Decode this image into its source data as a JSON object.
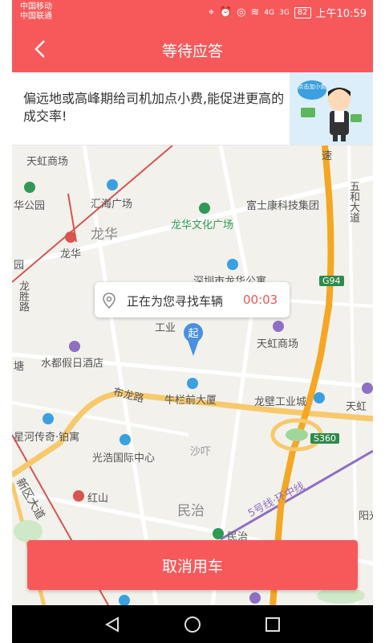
{
  "status_bar": {
    "carrier1": "中国移动",
    "carrier2": "中国联通",
    "signal1": "4G",
    "signal2": "3G",
    "battery": "82",
    "time": "上午10:59"
  },
  "header": {
    "title": "等待应答"
  },
  "tip": {
    "text": "偏远地或高峰期给司机加点小费,能促进更高的成交率!",
    "illustration_text": "点击加小费"
  },
  "map": {
    "labels": {
      "tianhong_top": "天虹商场",
      "huihuan": "汇海广场",
      "park": "华公园",
      "longhua_area": "龙华",
      "longhua_metro": "龙华",
      "yuan": "园",
      "longsheng_road": "龙胜路",
      "culture_plaza": "龙华文化广场",
      "fushikang": "富士康科技集团",
      "wuhe": "五和大道",
      "su": "速",
      "park_dept": "深圳市龙华公寓",
      "g94": "G94",
      "gongye": "工业",
      "tianhong_mid": "天虹商场",
      "shuidu": "水都假日酒店",
      "tang": "塘",
      "bulong_road": "布龙路",
      "niulanqian": "牛栏前大厦",
      "longbi": "龙壁工业城",
      "tianhong_right": "天虹",
      "xinghe": "星河传奇·铂寓",
      "guanghao": "光浩国际中心",
      "shaxia": "沙吓",
      "s360": "S360",
      "xinqu_road": "新区大道",
      "hongshan": "红山",
      "minzhi_area": "民治",
      "line5": "5号线·环中线",
      "minzhi_station": "民治",
      "yang": "阳光"
    }
  },
  "callout": {
    "message": "正在为您寻找车辆",
    "timer": "00:03",
    "pin_label": "起"
  },
  "cancel_label": "取消用车",
  "colors": {
    "brand": "#f7595a",
    "highway": "#f5a623",
    "metro": "#8e6fc4"
  }
}
